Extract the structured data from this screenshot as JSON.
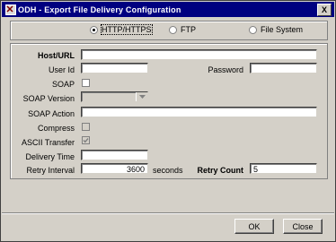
{
  "window": {
    "title": "ODH - Export File Delivery Configuration",
    "close_label": "X"
  },
  "delivery": {
    "options": [
      {
        "label": "HTTP/HTTPS",
        "selected": true
      },
      {
        "label": "FTP",
        "selected": false
      },
      {
        "label": "File System",
        "selected": false
      }
    ]
  },
  "form": {
    "host_url": {
      "label": "Host/URL",
      "value": ""
    },
    "user_id": {
      "label": "User Id",
      "value": ""
    },
    "password": {
      "label": "Password",
      "value": ""
    },
    "soap": {
      "label": "SOAP",
      "checked": false
    },
    "soap_version": {
      "label": "SOAP Version",
      "value": ""
    },
    "soap_action": {
      "label": "SOAP Action",
      "value": ""
    },
    "compress": {
      "label": "Compress",
      "checked": false
    },
    "ascii_transfer": {
      "label": "ASCII Transfer",
      "checked": true
    },
    "delivery_time": {
      "label": "Delivery Time",
      "value": ""
    },
    "retry_interval": {
      "label": "Retry Interval",
      "value": "3600",
      "unit": "seconds"
    },
    "retry_count": {
      "label": "Retry Count",
      "value": "5"
    }
  },
  "buttons": {
    "ok": "OK",
    "close": "Close"
  }
}
